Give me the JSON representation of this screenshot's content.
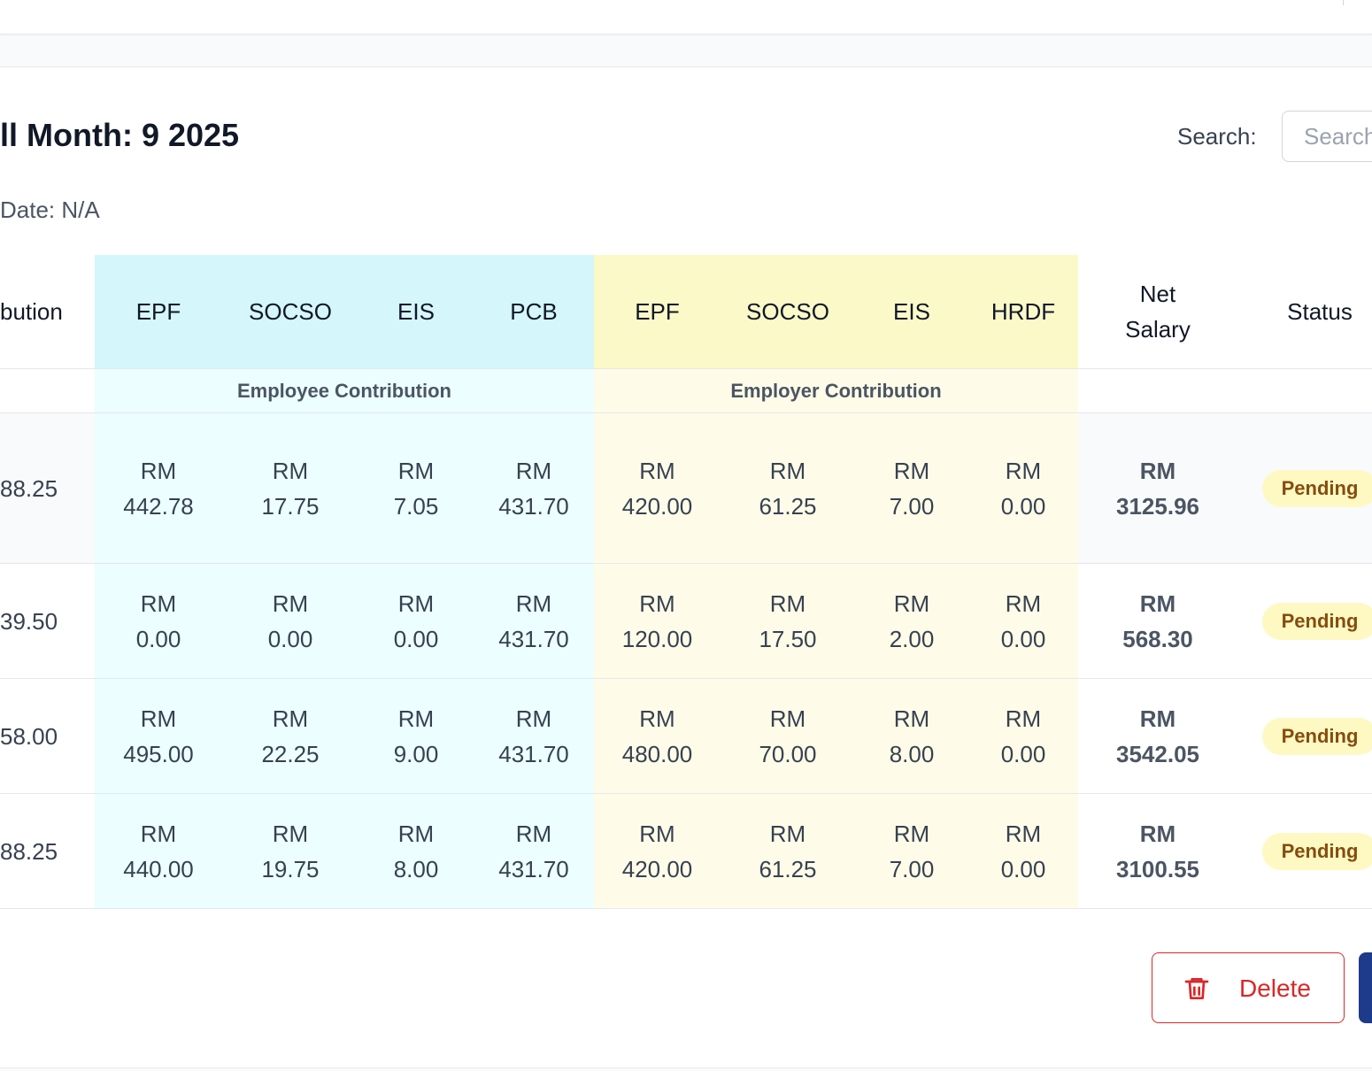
{
  "header": {
    "title": "ll Month: 9 2025",
    "date_line": "Date: N/A"
  },
  "search": {
    "label": "Search:",
    "placeholder": "Search"
  },
  "table": {
    "columns": {
      "contribution_partial": "bution",
      "employee": [
        "EPF",
        "SOCSO",
        "EIS",
        "PCB"
      ],
      "employer": [
        "EPF",
        "SOCSO",
        "EIS",
        "HRDF"
      ],
      "net_salary_line1": "Net",
      "net_salary_line2": "Salary",
      "status": "Status"
    },
    "groups": {
      "employee": "Employee Contribution",
      "employer": "Employer Contribution"
    },
    "currency": "RM",
    "rows": [
      {
        "partial": "88.25",
        "employee": [
          "442.78",
          "17.75",
          "7.05",
          "431.70"
        ],
        "employer": [
          "420.00",
          "61.25",
          "7.00",
          "0.00"
        ],
        "net": "3125.96",
        "status": "Pending"
      },
      {
        "partial": "39.50",
        "employee": [
          "0.00",
          "0.00",
          "0.00",
          "431.70"
        ],
        "employer": [
          "120.00",
          "17.50",
          "2.00",
          "0.00"
        ],
        "net": "568.30",
        "status": "Pending"
      },
      {
        "partial": "58.00",
        "employee": [
          "495.00",
          "22.25",
          "9.00",
          "431.70"
        ],
        "employer": [
          "480.00",
          "70.00",
          "8.00",
          "0.00"
        ],
        "net": "3542.05",
        "status": "Pending"
      },
      {
        "partial": "88.25",
        "employee": [
          "440.00",
          "19.75",
          "8.00",
          "431.70"
        ],
        "employer": [
          "420.00",
          "61.25",
          "7.00",
          "0.00"
        ],
        "net": "3100.55",
        "status": "Pending"
      }
    ]
  },
  "actions": {
    "delete_label": "Delete"
  },
  "colors": {
    "employee_header": "#d5f6fb",
    "employer_header": "#fcf9c9",
    "pending_badge": "#fef9c3",
    "delete": "#dc2626",
    "primary": "#1e3a8a"
  },
  "icons": {
    "delete": "trash-icon"
  }
}
